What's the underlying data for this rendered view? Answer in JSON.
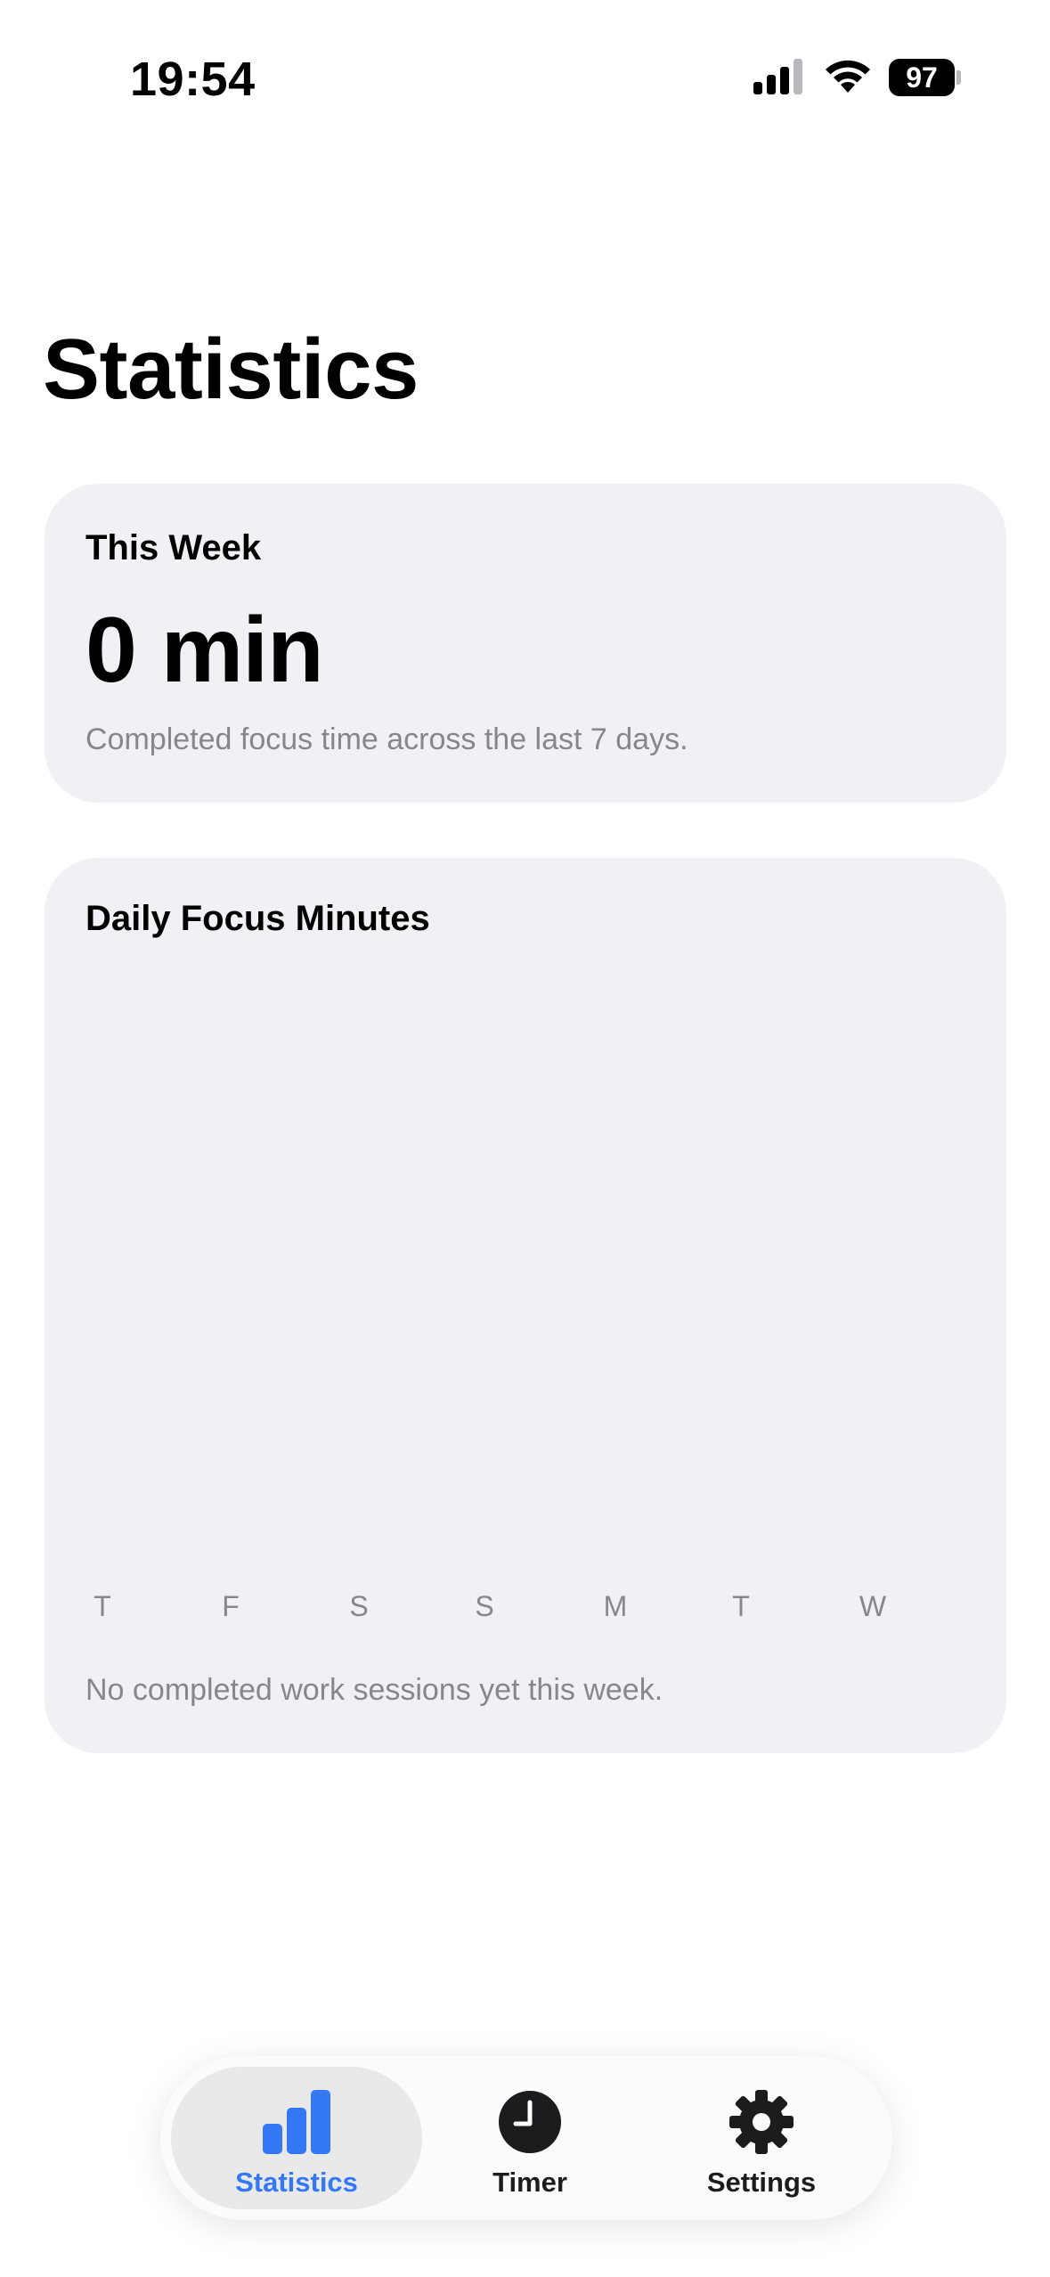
{
  "status_bar": {
    "time": "19:54",
    "battery": "97",
    "icons": [
      "cellular-signal-icon",
      "wifi-icon",
      "battery-icon"
    ]
  },
  "page": {
    "title": "Statistics"
  },
  "week_card": {
    "heading": "This Week",
    "total": "0 min",
    "caption": "Completed focus time across the last 7 days."
  },
  "chart_card": {
    "heading": "Daily Focus Minutes",
    "caption": "No completed work sessions yet this week."
  },
  "chart_data": {
    "type": "bar",
    "categories": [
      "T",
      "F",
      "S",
      "S",
      "M",
      "T",
      "W"
    ],
    "values": [
      0,
      0,
      0,
      0,
      0,
      0,
      0
    ],
    "title": "Daily Focus Minutes",
    "xlabel": "",
    "ylabel": "",
    "grid": false,
    "accent_color": "#3478f6"
  },
  "tab_bar": {
    "items": [
      {
        "label": "Statistics",
        "icon": "bar-chart-icon",
        "selected": true
      },
      {
        "label": "Timer",
        "icon": "clock-icon",
        "selected": false
      },
      {
        "label": "Settings",
        "icon": "gear-icon",
        "selected": false
      }
    ],
    "accent_color": "#3478f6"
  }
}
